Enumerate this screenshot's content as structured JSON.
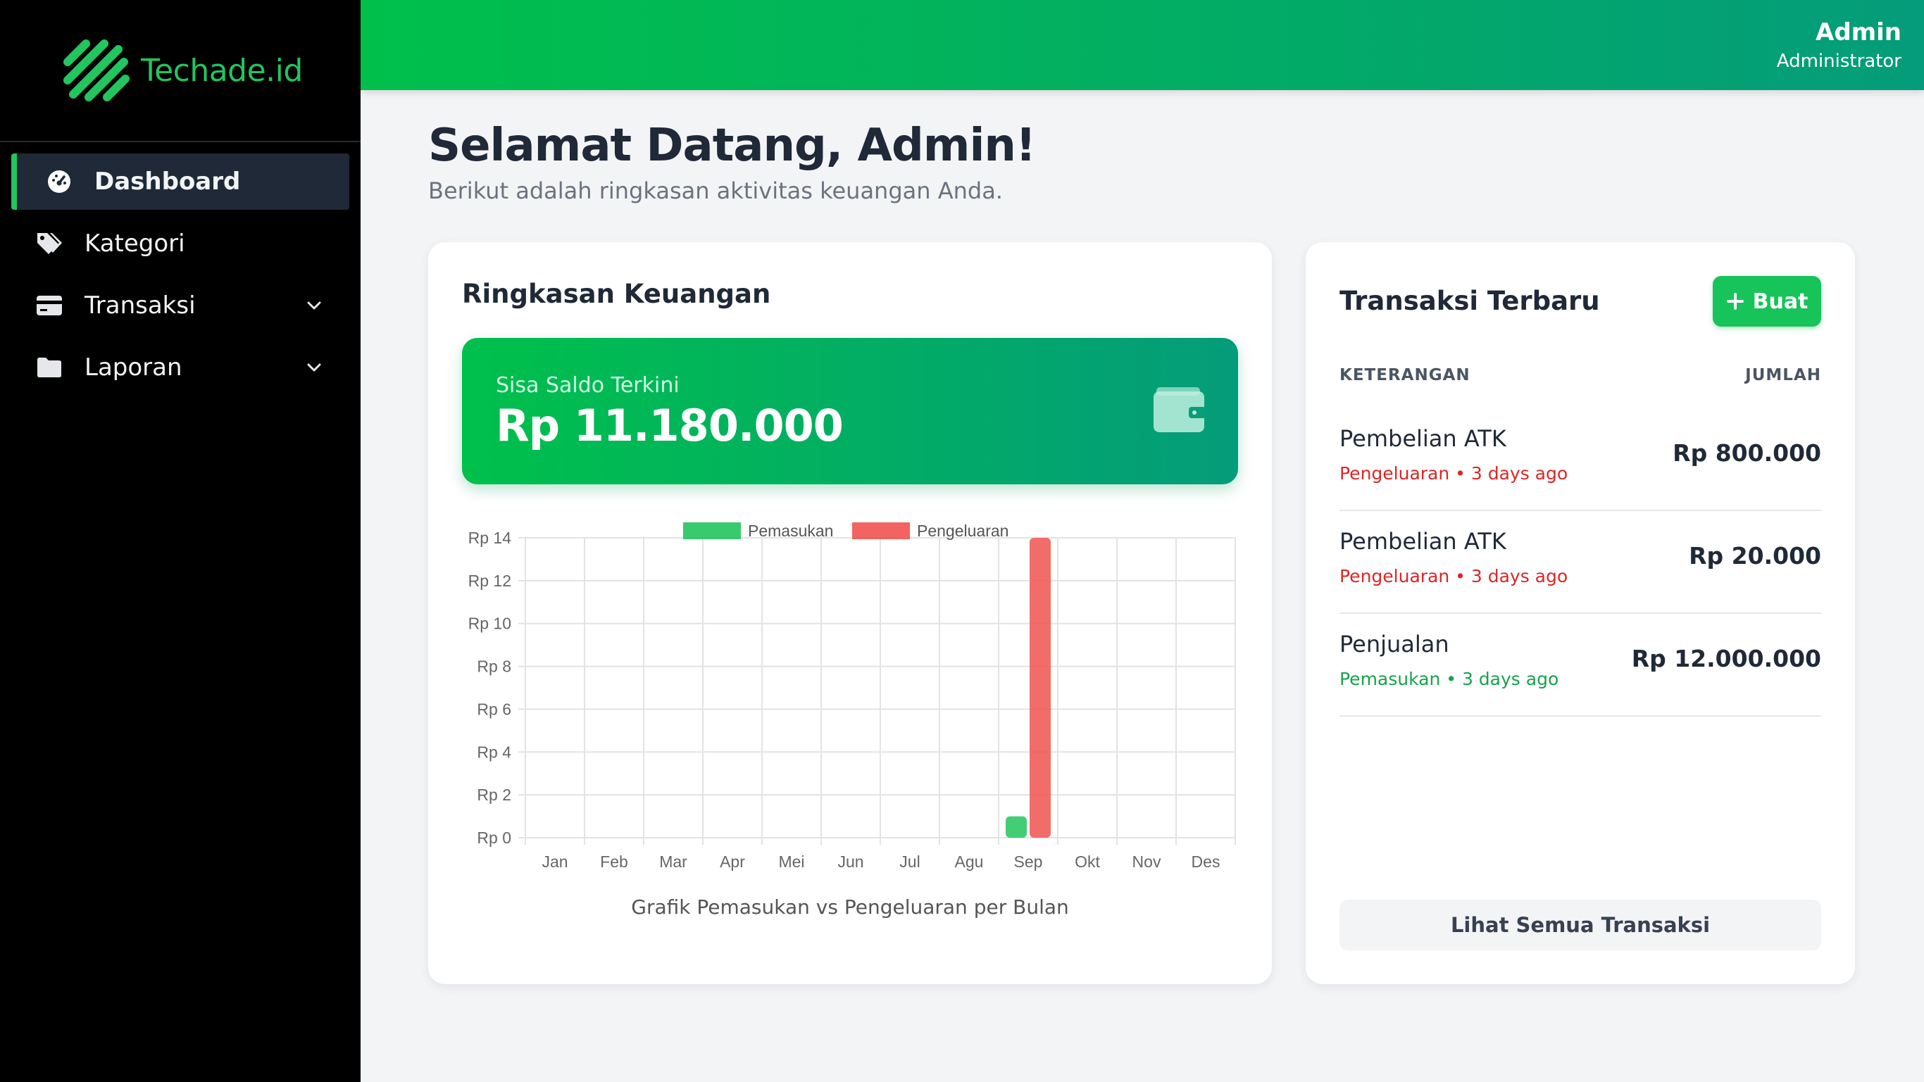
{
  "brand": {
    "name": "Techade.id",
    "accent": "#22c55e"
  },
  "sidebar": {
    "items": [
      {
        "label": "Dashboard",
        "icon": "gauge-icon",
        "active": true
      },
      {
        "label": "Kategori",
        "icon": "tag-icon"
      },
      {
        "label": "Transaksi",
        "icon": "credit-card-icon",
        "has_submenu": true
      },
      {
        "label": "Laporan",
        "icon": "folder-icon",
        "has_submenu": true
      }
    ]
  },
  "user": {
    "name": "Admin",
    "role": "Administrator"
  },
  "welcome": {
    "title": "Selamat Datang, Admin!",
    "subtitle": "Berikut adalah ringkasan aktivitas keuangan Anda."
  },
  "summary": {
    "title": "Ringkasan Keuangan",
    "balance_label": "Sisa Saldo Terkini",
    "balance_value": "Rp 11.180.000"
  },
  "chart_data": {
    "type": "bar",
    "categories": [
      "Jan",
      "Feb",
      "Mar",
      "Apr",
      "Mei",
      "Jun",
      "Jul",
      "Agu",
      "Sep",
      "Okt",
      "Nov",
      "Des"
    ],
    "series": [
      {
        "name": "Pemasukan",
        "color": "#22c55e",
        "values": [
          0,
          0,
          0,
          0,
          0,
          0,
          0,
          0,
          1,
          0,
          0,
          0
        ]
      },
      {
        "name": "Pengeluaran",
        "color": "#ef5350",
        "values": [
          0,
          0,
          0,
          0,
          0,
          0,
          0,
          0,
          14,
          0,
          0,
          0
        ]
      }
    ],
    "y_ticks": [
      "Rp 0",
      "Rp 2",
      "Rp 4",
      "Rp 6",
      "Rp 8",
      "Rp 10",
      "Rp 12",
      "Rp 14"
    ],
    "ylim": [
      0,
      14
    ],
    "xlabel": "Grafik Pemasukan vs Pengeluaran per Bulan",
    "legend": "top-center",
    "grid": true
  },
  "recent": {
    "title": "Transaksi Terbaru",
    "create_label": "Buat",
    "col_desc": "KETERANGAN",
    "col_amount": "JUMLAH",
    "items": [
      {
        "name": "Pembelian ATK",
        "type": "Pengeluaran",
        "time": "3 days ago",
        "amount": "Rp 800.000",
        "meta": "Pengeluaran • 3 days ago"
      },
      {
        "name": "Pembelian ATK",
        "type": "Pengeluaran",
        "time": "3 days ago",
        "amount": "Rp 20.000",
        "meta": "Pengeluaran • 3 days ago"
      },
      {
        "name": "Penjualan",
        "type": "Pemasukan",
        "time": "3 days ago",
        "amount": "Rp 12.000.000",
        "meta": "Pemasukan • 3 days ago"
      }
    ],
    "view_all_label": "Lihat Semua Transaksi"
  }
}
